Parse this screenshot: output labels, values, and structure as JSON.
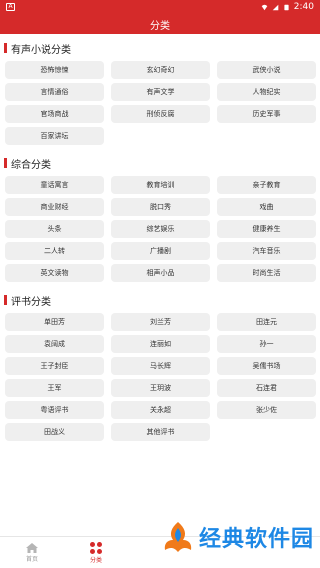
{
  "status": {
    "time": "2:40"
  },
  "header": {
    "title": "分类"
  },
  "sections": [
    {
      "title": "有声小说分类",
      "items": [
        "恐怖惊悚",
        "玄幻奇幻",
        "武侠小说",
        "言情通俗",
        "有声文学",
        "人物纪实",
        "官场商战",
        "刑侦反腐",
        "历史军事",
        "百家讲坛"
      ]
    },
    {
      "title": "综合分类",
      "items": [
        "童话寓言",
        "教育培训",
        "亲子教育",
        "商业财经",
        "脱口秀",
        "戏曲",
        "头条",
        "综艺娱乐",
        "健康养生",
        "二人转",
        "广播剧",
        "汽车音乐",
        "英文读物",
        "相声小品",
        "时尚生活"
      ]
    },
    {
      "title": "评书分类",
      "items": [
        "单田芳",
        "刘兰芳",
        "田连元",
        "袁阔成",
        "连丽如",
        "孙一",
        "王子封臣",
        "马长辉",
        "吴儒书场",
        "王军",
        "王玥波",
        "石连君",
        "粤语评书",
        "关永超",
        "张少佐",
        "田战义",
        "其他评书"
      ]
    }
  ],
  "tabbar": {
    "tabs": [
      {
        "label": "首页",
        "icon": "home-icon"
      },
      {
        "label": "分类",
        "icon": "category-grid-icon"
      }
    ],
    "active": 1
  },
  "watermark": {
    "text": "经典软件园"
  },
  "colors": {
    "primary": "#d52a2a",
    "chip_bg": "#efefef",
    "watermark": "#1e88e5"
  }
}
